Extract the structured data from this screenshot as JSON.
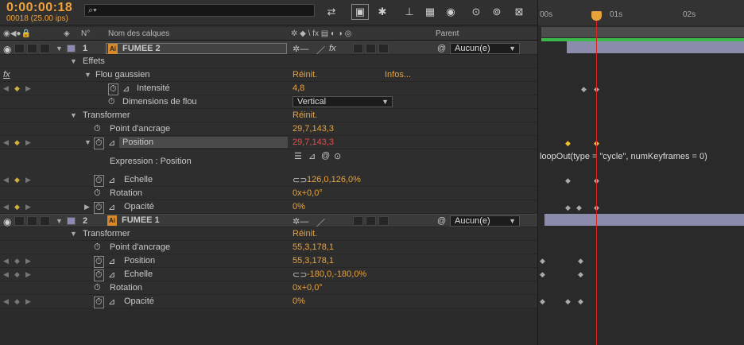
{
  "header": {
    "timecode": "0:00:00:18",
    "framecount": "00018 (25.00 ips)",
    "search_placeholder": "",
    "search_icon": "search-icon"
  },
  "columns": {
    "num": "N°",
    "layer_name": "Nom des calques",
    "parent": "Parent"
  },
  "timeline": {
    "ticks": [
      "00s",
      "01s",
      "02s"
    ],
    "expression_text": "loopOut(type = \"cycle\", numKeyframes = 0)"
  },
  "layers": [
    {
      "num": "1",
      "name": "FUMEE 2",
      "parent": "Aucun(e)"
    },
    {
      "num": "2",
      "name": "FUMEE 1",
      "parent": "Aucun(e)"
    }
  ],
  "rows": {
    "effets": "Effets",
    "flou": "Flou gaussien",
    "flou_reset": "Réinit.",
    "flou_info": "Infos...",
    "intensite": "Intensité",
    "intensite_val": "4,8",
    "dim": "Dimensions de flou",
    "dim_val": "Vertical",
    "transformer": "Transformer",
    "transformer_reset": "Réinit.",
    "ancrage": "Point d'ancrage",
    "ancrage_val": "29,7,143,3",
    "position": "Position",
    "position_val": "29,7,143,3",
    "expression": "Expression : Position",
    "echelle": "Echelle",
    "echelle_val": "126,0,126,0%",
    "rotation": "Rotation",
    "rotation_val": "0x+0,0°",
    "opacite": "Opacité",
    "opacite_val": "0%",
    "transformer2": "Transformer",
    "transformer2_reset": "Réinit.",
    "ancrage2": "Point d'ancrage",
    "ancrage2_val": "55,3,178,1",
    "position2": "Position",
    "position2_val": "55,3,178,1",
    "echelle2": "Echelle",
    "echelle2_val": "-180,0,-180,0%",
    "rotation2": "Rotation",
    "rotation2_val": "0x+0,0°",
    "opacite2": "Opacité",
    "opacite2_val": "0%"
  },
  "fx_label": "fx"
}
